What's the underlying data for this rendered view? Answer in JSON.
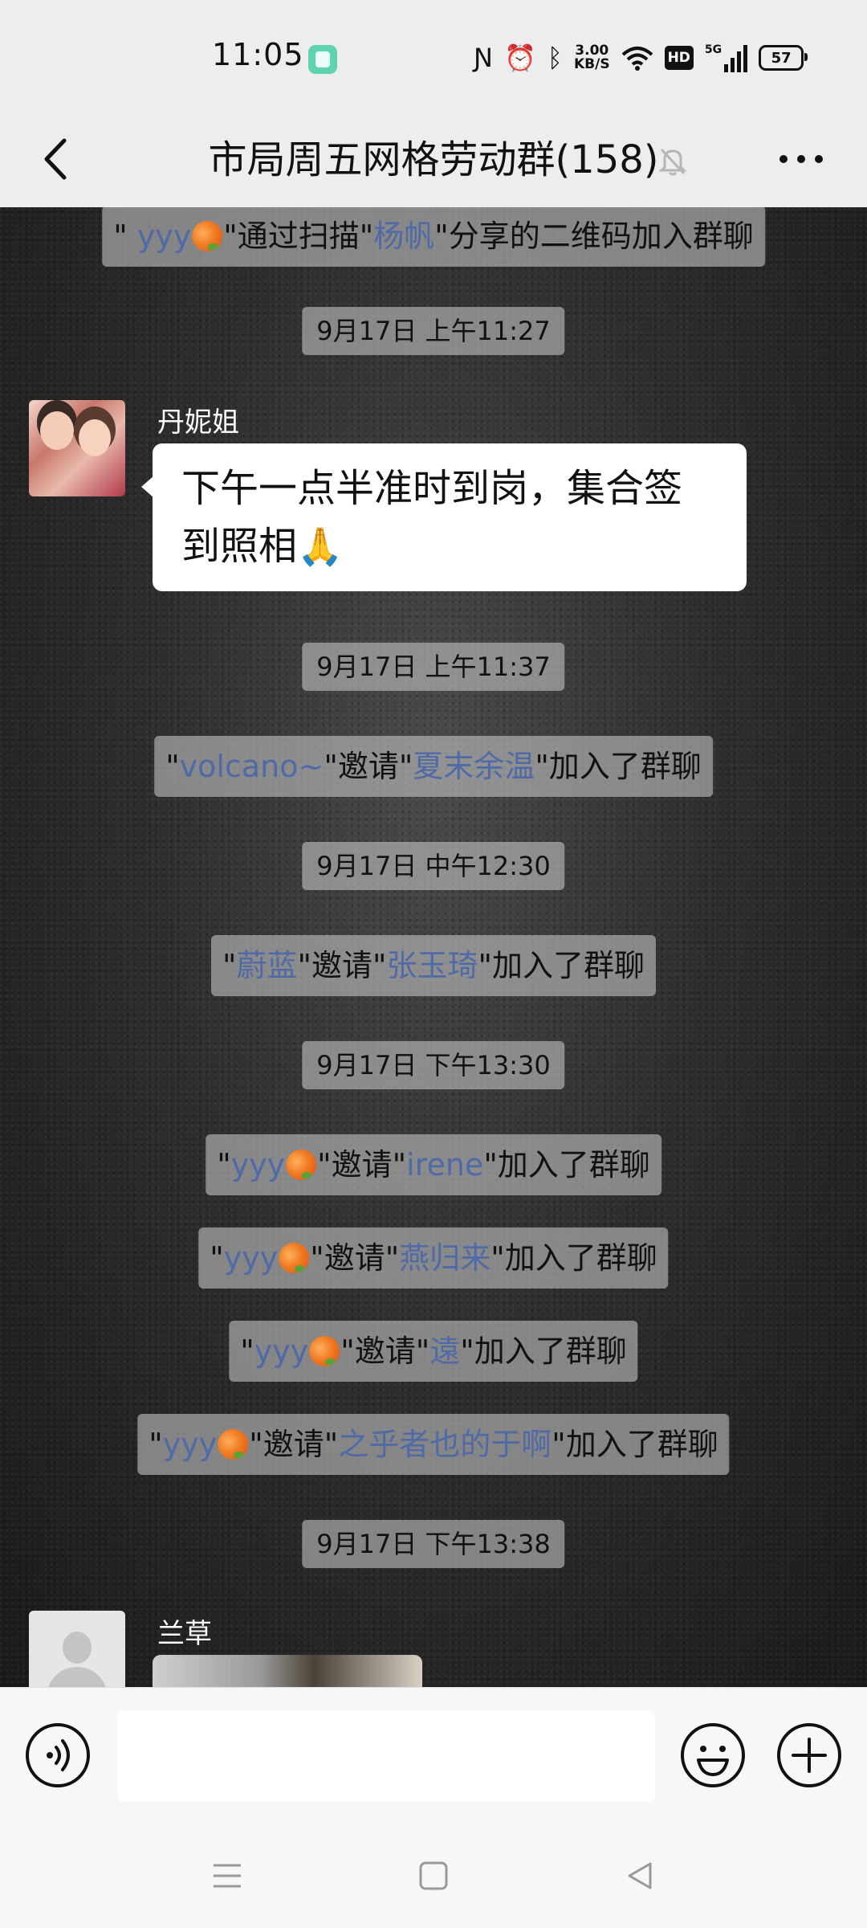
{
  "status_bar": {
    "time": "11:05",
    "speed_value": "3.00",
    "speed_unit": "KB/S",
    "hd": "HD",
    "network": "5G",
    "battery": "57"
  },
  "header": {
    "title": "市局周五网格劳动群(158)"
  },
  "messages": {
    "m0": {
      "pre": "\" ",
      "actor": "yyy",
      "mid": "\"通过扫描\"",
      "target": "杨帆",
      "post": "\"分享的二维码加入群聊"
    },
    "t1": "9月17日 上午11:27",
    "msg1": {
      "sender": "丹妮姐",
      "text": "下午一点半准时到岗，集合签到照相"
    },
    "t2": "9月17日 上午11:37",
    "m2": {
      "pre": "\"",
      "actor": "volcano~",
      "mid": "\"邀请\"",
      "target": "夏末余温",
      "post": "\"加入了群聊"
    },
    "t3": "9月17日 中午12:30",
    "m3": {
      "pre": "\"",
      "actor": "蔚蓝",
      "mid": "\"邀请\"",
      "target": "张玉琦",
      "post": "\"加入了群聊"
    },
    "t4": "9月17日 下午13:30",
    "m4": {
      "pre": "\"",
      "actor": "yyy",
      "mid": "\"邀请\"",
      "target": "irene",
      "post": "\"加入了群聊"
    },
    "m5": {
      "pre": "\"",
      "actor": "yyy",
      "mid": "\"邀请\"",
      "target": "燕归来",
      "post": "\"加入了群聊"
    },
    "m6": {
      "pre": "\"",
      "actor": "yyy",
      "mid": "\"邀请\"",
      "target": "遠",
      "post": "\"加入了群聊"
    },
    "m7": {
      "pre": "\"",
      "actor": "yyy",
      "mid": "\"邀请\"",
      "target": "之乎者也的于啊",
      "post": "\"加入了群聊"
    },
    "t5": "9月17日 下午13:38",
    "msg2": {
      "sender": "兰草"
    }
  },
  "icons": {
    "back": "chevron-left-icon",
    "mute": "bell-off-icon",
    "more": "more-dots-icon",
    "voice": "voice-icon",
    "emoji": "emoji-icon",
    "plus": "plus-icon"
  }
}
